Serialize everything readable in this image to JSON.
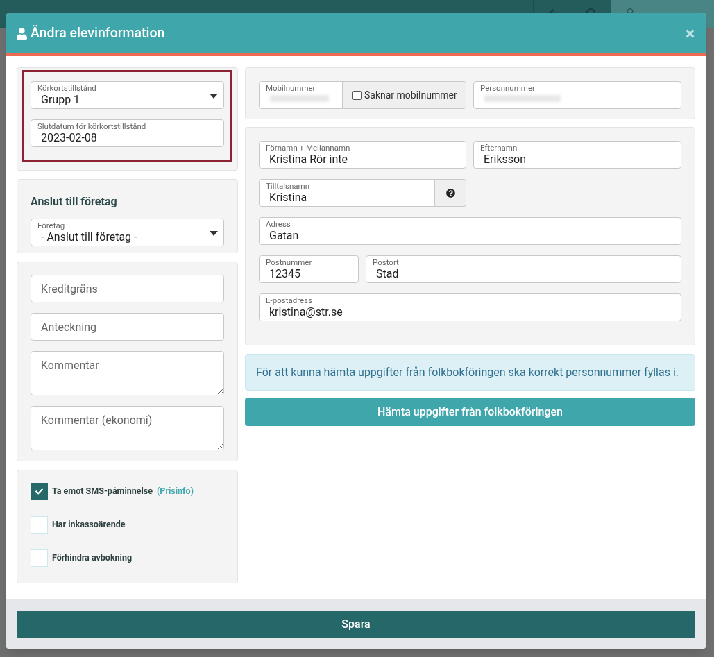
{
  "modal": {
    "title": "Ändra elevinformation",
    "permit": {
      "fields": [
        {
          "label": "Körkortstillstånd",
          "value": "Grupp 1",
          "kind": "select"
        },
        {
          "label": "Slutdatum för körkortstillstånd",
          "value": "2023-02-08",
          "kind": "input"
        }
      ]
    },
    "company": {
      "heading": "Anslut till företag",
      "field": {
        "label": "Företag",
        "value": "- Anslut till företag -"
      }
    },
    "notes": [
      {
        "placeholder": "Kreditgräns",
        "kind": "input"
      },
      {
        "placeholder": "Anteckning",
        "kind": "input"
      },
      {
        "placeholder": "Kommentar",
        "kind": "textarea"
      },
      {
        "placeholder": "Kommentar (ekonomi)",
        "kind": "textarea"
      }
    ],
    "options": [
      {
        "label": "Ta emot SMS-påminnelse",
        "link": "(Prisinfo)",
        "checked": true
      },
      {
        "label": "Har inkassoärende",
        "checked": false
      },
      {
        "label": "Förhindra avbokning",
        "checked": false
      }
    ],
    "mobile": {
      "label": "Mobilnummer",
      "no_mobile": {
        "label": "Saknar mobilnummer",
        "checked": false
      }
    },
    "personal_number": {
      "label": "Personnummer"
    },
    "first_name": {
      "label": "Förnamn + Mellannamn",
      "value": "Kristina Rör inte"
    },
    "last_name": {
      "label": "Efternamn",
      "value": "Eriksson"
    },
    "nickname": {
      "label": "Tilltalsnamn",
      "value": "Kristina"
    },
    "address": {
      "label": "Adress",
      "value": "Gatan"
    },
    "postal_code": {
      "label": "Postnummer",
      "value": "12345"
    },
    "city": {
      "label": "Postort",
      "value": "Stad"
    },
    "email": {
      "label": "E-postadress",
      "value": "kristina@str.se"
    },
    "info": "För att kunna hämta uppgifter från folkbokföringen ska korrekt personnummer fyllas i.",
    "fetch_button": "Hämta uppgifter från folkbokföringen",
    "save_button": "Spara"
  }
}
